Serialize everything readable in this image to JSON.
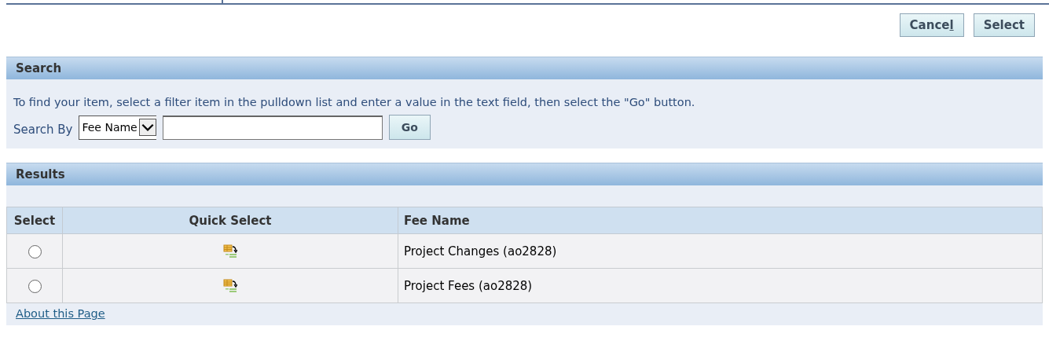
{
  "buttons": [
    {
      "label_parts": [
        {
          "text": "Cance",
          "underlined": false
        },
        {
          "text": "l",
          "underlined": true
        }
      ]
    },
    {
      "label_parts": [
        {
          "text": "Select",
          "underlined": false
        }
      ]
    }
  ],
  "search": {
    "title": "Search",
    "instructions": "To find your item, select a filter item in the pulldown list and enter a value in the text field, then select the \"Go\" button.",
    "search_by_label": "Search By",
    "filter_value": "Fee Name",
    "go_button": "Go"
  },
  "results": {
    "title": "Results",
    "columns": [
      "Select",
      "Quick Select",
      "Fee Name"
    ],
    "rows": [
      {
        "selected": false,
        "fee_name": "Project Changes (ao2828)"
      },
      {
        "selected": false,
        "fee_name": "Project Fees (ao2828)"
      }
    ]
  },
  "footer_link": "About this Page"
}
